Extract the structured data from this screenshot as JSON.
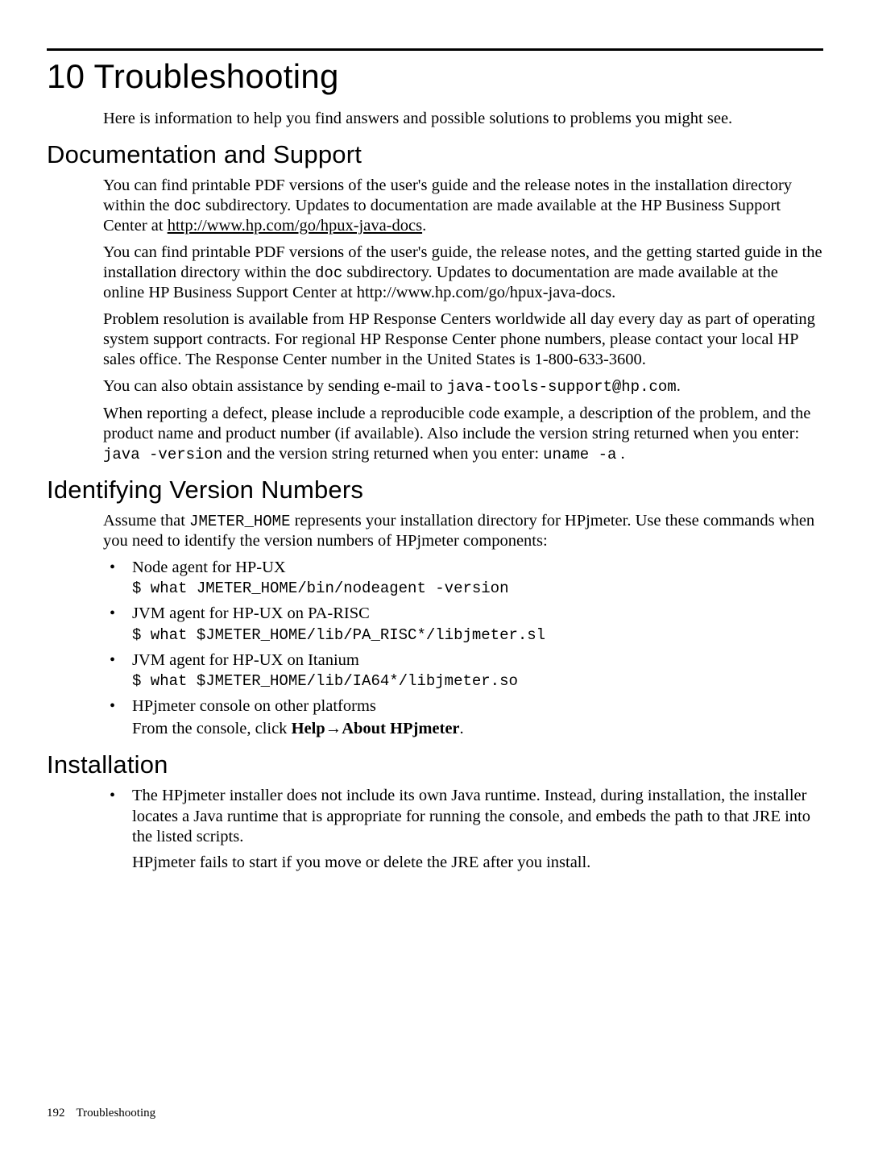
{
  "chapter": {
    "title": "10 Troubleshooting"
  },
  "intro": "Here is information to help you find answers and possible solutions to problems you might see.",
  "sections": {
    "docsupport": {
      "title": "Documentation and Support",
      "p1a": "You can find printable PDF versions of the user's guide and the release notes in the installation directory within the ",
      "p1_code": "doc",
      "p1b": " subdirectory. Updates to documentation are made available at the HP Business Support Center at ",
      "p1_link": "http://www.hp.com/go/hpux-java-docs",
      "p1c": ".",
      "p2a": "You can find printable PDF versions of the user's guide, the release notes, and the getting started guide in the installation directory within the ",
      "p2_code": "doc",
      "p2b": " subdirectory. Updates to documentation are made available at the online HP Business Support Center at http://www.hp.com/go/hpux-java-docs.",
      "p3": "Problem resolution is available from HP Response Centers worldwide all day every day as part of operating system support contracts. For regional HP Response Center phone numbers, please contact your local HP sales office. The Response Center number in the United States is 1-800-633-3600.",
      "p4a": "You can also obtain assistance by sending e-mail to ",
      "p4_code": "java-tools-support@hp.com",
      "p4b": ".",
      "p5a": "When reporting a defect, please include a reproducible code example, a description of the problem, and the product name and product number (if available). Also include the version string returned when you enter: ",
      "p5_code1": "java -version",
      "p5b": " and the version string returned when you enter: ",
      "p5_code2": "uname -a",
      "p5c": " ."
    },
    "version": {
      "title": "Identifying Version Numbers",
      "intro_a": "Assume that ",
      "intro_code": "JMETER_HOME",
      "intro_b": " represents your installation directory for HPjmeter. Use these commands when you need to identify the version numbers of HPjmeter components:",
      "items": [
        {
          "label": "Node agent for HP-UX",
          "cmd": "$ what JMETER_HOME/bin/nodeagent -version"
        },
        {
          "label": "JVM agent for HP-UX on PA-RISC",
          "cmd": "$ what $JMETER_HOME/lib/PA_RISC*/libjmeter.sl"
        },
        {
          "label": "JVM agent for HP-UX on Itanium",
          "cmd": "$ what $JMETER_HOME/lib/IA64*/libjmeter.so"
        }
      ],
      "item4_label": "HPjmeter console on other platforms",
      "item4_text_a": "From the console, click ",
      "item4_bold1": "Help",
      "item4_arrow": "→",
      "item4_bold2": "About HPjmeter",
      "item4_text_b": "."
    },
    "install": {
      "title": "Installation",
      "b1a": "The HPjmeter installer does not include its own Java runtime. Instead, during installation, the installer locates a Java runtime that is appropriate for running the console, and embeds the path to that JRE into the listed scripts.",
      "b1b": "HPjmeter fails to start if you move or delete the JRE after you install."
    }
  },
  "footer": {
    "page": "192",
    "section": "Troubleshooting"
  }
}
